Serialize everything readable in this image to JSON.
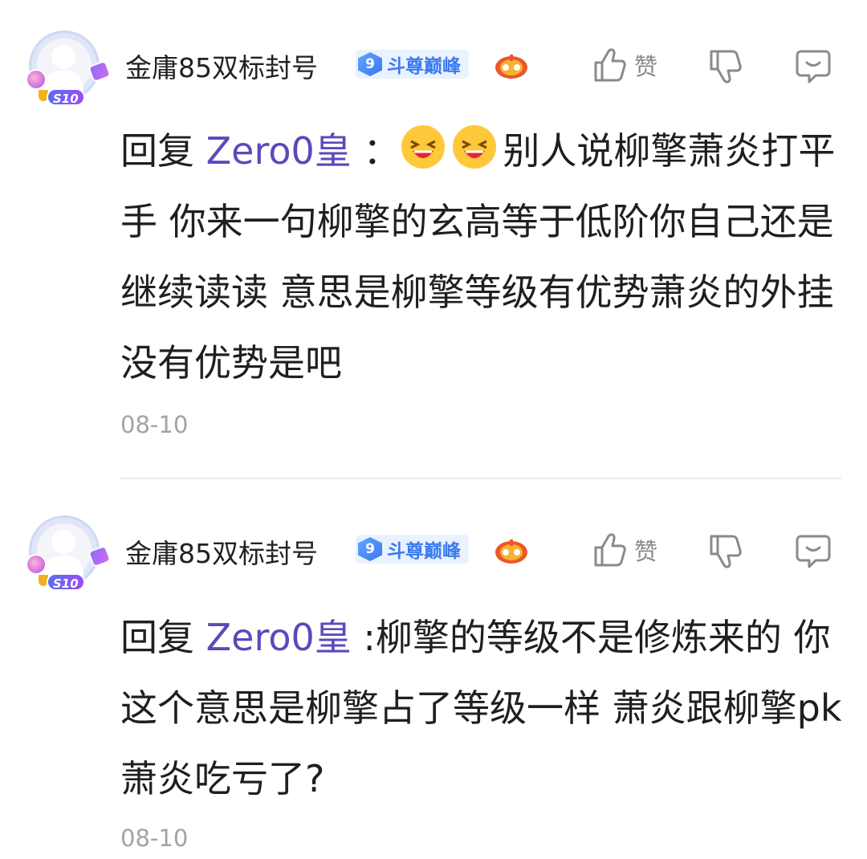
{
  "replies": [
    {
      "username": "金庸85双标封号",
      "level_number": "9",
      "level_title": "斗尊巅峰",
      "avatar_badge": "S10",
      "reply_prefix": "回复",
      "reply_target": "Zero0皇",
      "separator": "：",
      "emojis": [
        "laughing-emoji",
        "laughing-emoji"
      ],
      "text": "别人说柳擎萧炎打平手 你来一句柳擎的玄高等于低阶你自己还是继续读读 意思是柳擎等级有优势萧炎的外挂没有优势是吧",
      "timestamp": "08-10",
      "like_label": "赞"
    },
    {
      "username": "金庸85双标封号",
      "level_number": "9",
      "level_title": "斗尊巅峰",
      "avatar_badge": "S10",
      "reply_prefix": "回复",
      "reply_target": "Zero0皇",
      "separator": ":",
      "text": "柳擎的等级不是修炼来的 你这个意思是柳擎占了等级一样 萧炎跟柳擎pk萧炎吃亏了?",
      "timestamp": "08-10",
      "like_label": "赞"
    }
  ],
  "colors": {
    "reply_target": "#5a4ab9",
    "timestamp": "#a3a3a3",
    "level_title": "#3a7af0",
    "level_bg": "#eaf2ff"
  }
}
